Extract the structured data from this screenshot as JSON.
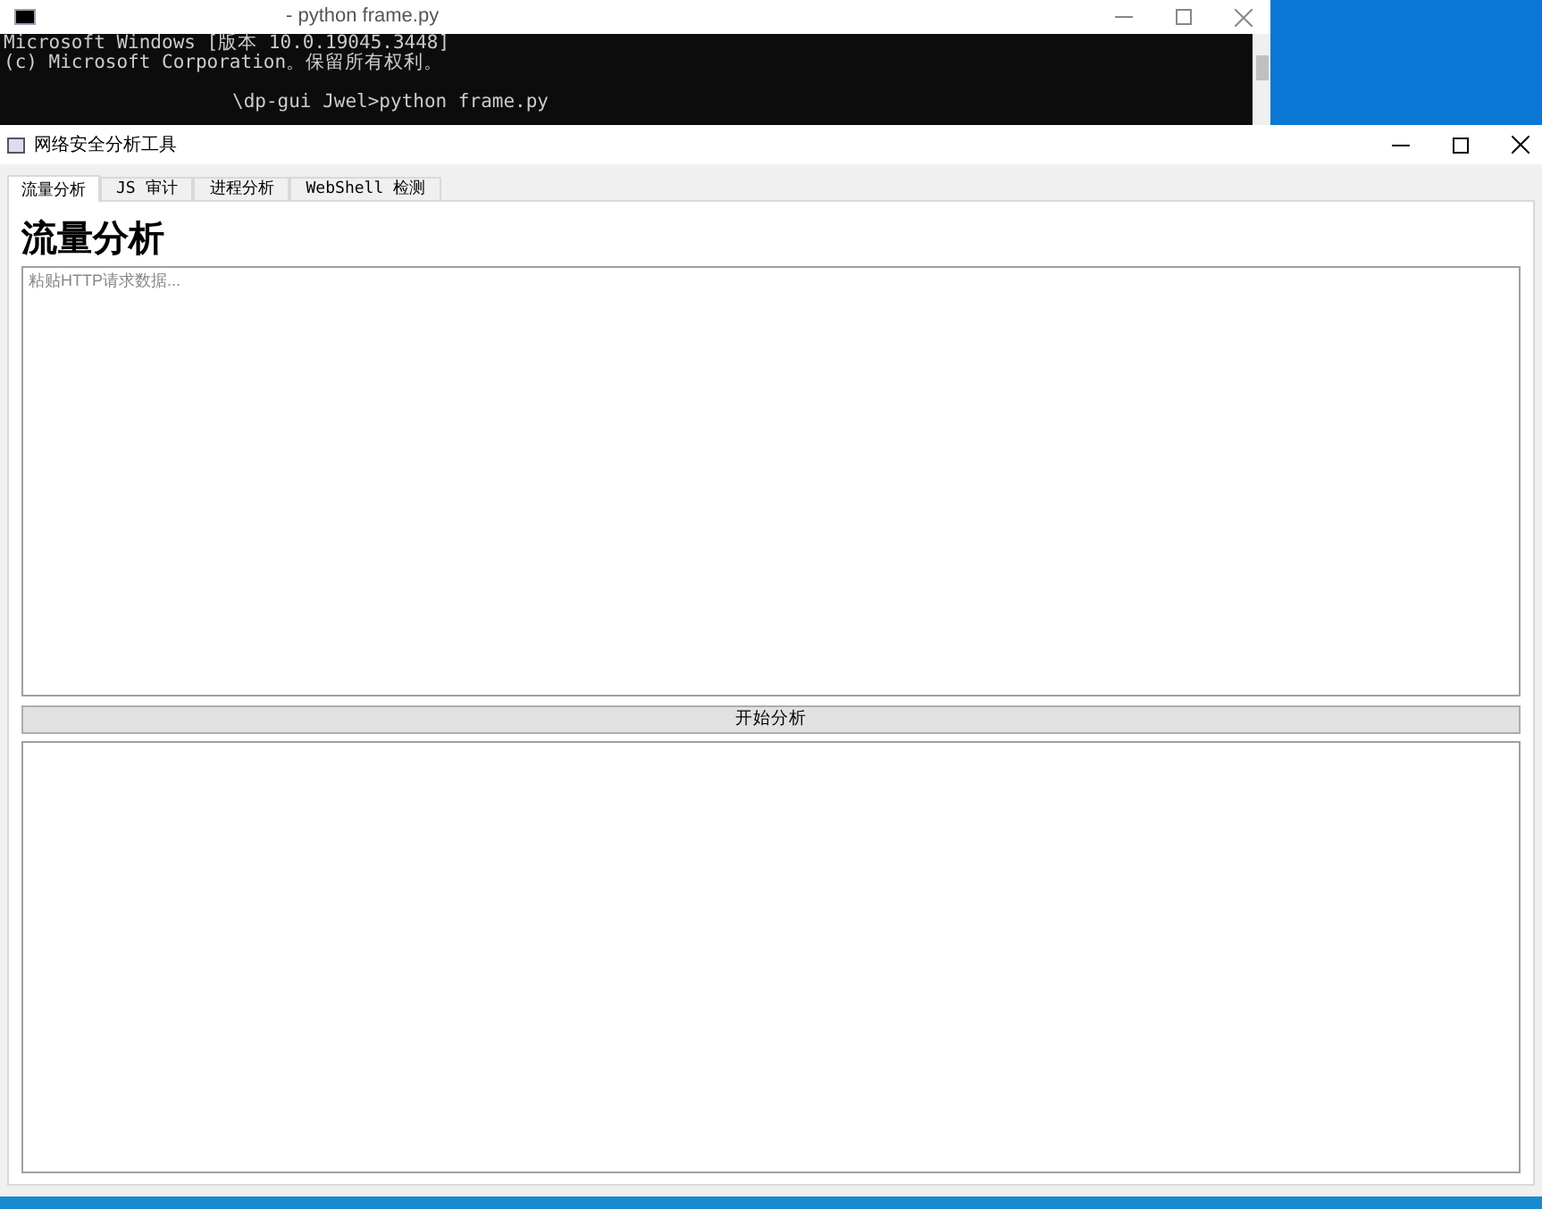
{
  "console_window": {
    "title": "- python  frame.py",
    "lines": [
      "Microsoft Windows [版本 10.0.19045.3448]",
      "(c) Microsoft Corporation。保留所有权利。",
      "\\dp-gui Jwel>python frame.py"
    ]
  },
  "window": {
    "title": "网络安全分析工具"
  },
  "tabs": [
    {
      "label": "流量分析",
      "selected": true
    },
    {
      "label": "JS 审计",
      "selected": false
    },
    {
      "label": "进程分析",
      "selected": false
    },
    {
      "label": "WebShell 检测",
      "selected": false
    }
  ],
  "heading": "流量分析",
  "request_field": {
    "placeholder": "粘贴HTTP请求数据..."
  },
  "analyze_button": "开始分析"
}
